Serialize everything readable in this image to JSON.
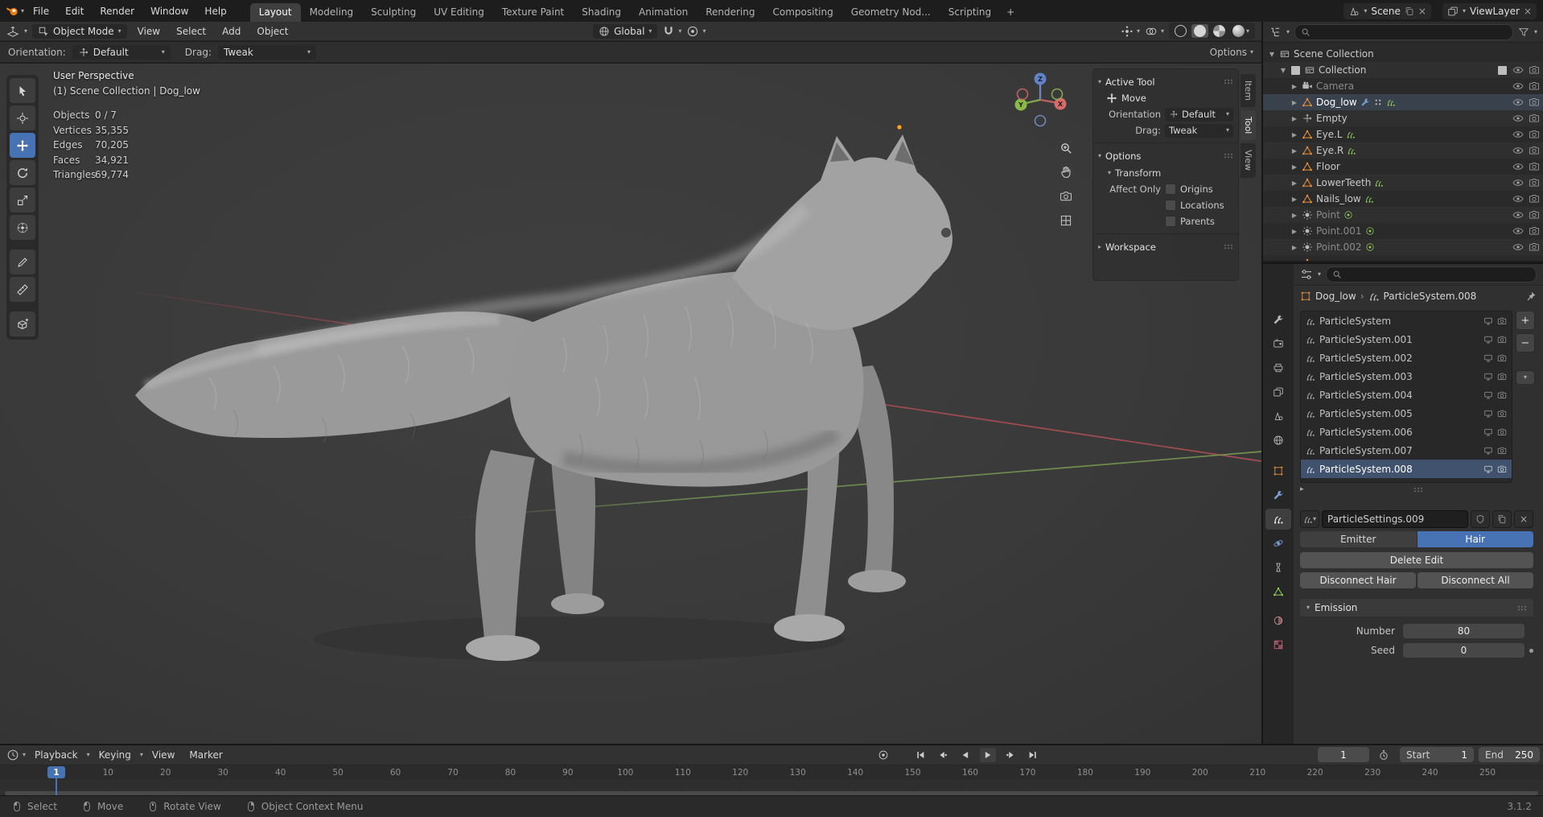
{
  "colors": {
    "accent": "#4772b3",
    "object_orange": "#e8913a",
    "mesh_green": "#8fce5a"
  },
  "topbar": {
    "menus": [
      "File",
      "Edit",
      "Render",
      "Window",
      "Help"
    ],
    "workspaces": [
      "Layout",
      "Modeling",
      "Sculpting",
      "UV Editing",
      "Texture Paint",
      "Shading",
      "Animation",
      "Rendering",
      "Compositing",
      "Geometry Nod...",
      "Scripting"
    ],
    "active_workspace": "Layout",
    "add_workspace": "+",
    "scene_name": "Scene",
    "view_layer_name": "ViewLayer"
  },
  "viewport_header": {
    "mode": "Object Mode",
    "menus": [
      "View",
      "Select",
      "Add",
      "Object"
    ],
    "orientation": "Global"
  },
  "tool_settings": {
    "orientation_label": "Orientation:",
    "orientation_value": "Default",
    "drag_label": "Drag:",
    "drag_value": "Tweak",
    "options_label": "Options"
  },
  "viewport": {
    "view_label": "User Perspective",
    "context_label": "(1) Scene Collection | Dog_low",
    "stats": [
      {
        "label": "Objects",
        "value": "0 / 7"
      },
      {
        "label": "Vertices",
        "value": "35,355"
      },
      {
        "label": "Edges",
        "value": "70,205"
      },
      {
        "label": "Faces",
        "value": "34,921"
      },
      {
        "label": "Triangles",
        "value": "69,774"
      }
    ],
    "axis": {
      "x": "X",
      "y": "Y",
      "z": "Z"
    }
  },
  "npanel": {
    "active_tool_label": "Active Tool",
    "tool_name": "Move",
    "orientation_label": "Orientation",
    "orientation_value": "Default",
    "drag_label": "Drag:",
    "drag_value": "Tweak",
    "options_label": "Options",
    "transform_label": "Transform",
    "affect_only_label": "Affect Only",
    "checkboxes": [
      "Origins",
      "Locations",
      "Parents"
    ],
    "workspace_label": "Workspace",
    "tabs": [
      "Item",
      "Tool",
      "View"
    ],
    "active_tab": "Tool"
  },
  "outliner": {
    "rows": [
      {
        "name": "Scene Collection"
      },
      {
        "name": "Collection"
      },
      {
        "name": "Camera"
      },
      {
        "name": "Dog_low"
      },
      {
        "name": "Empty"
      },
      {
        "name": "Eye.L"
      },
      {
        "name": "Eye.R"
      },
      {
        "name": "Floor"
      },
      {
        "name": "LowerTeeth"
      },
      {
        "name": "Nails_low"
      },
      {
        "name": "Point"
      },
      {
        "name": "Point.001"
      },
      {
        "name": "Point.002"
      }
    ]
  },
  "properties": {
    "breadcrumb": {
      "object": "Dog_low",
      "item": "ParticleSystem.008",
      "separator": "›"
    },
    "particle_systems": [
      "ParticleSystem",
      "ParticleSystem.001",
      "ParticleSystem.002",
      "ParticleSystem.003",
      "ParticleSystem.004",
      "ParticleSystem.005",
      "ParticleSystem.006",
      "ParticleSystem.007",
      "ParticleSystem.008"
    ],
    "active_particle_system": "ParticleSystem.008",
    "settings_name": "ParticleSettings.009",
    "emitter_label": "Emitter",
    "hair_label": "Hair",
    "active_type": "Hair",
    "delete_edit_label": "Delete Edit",
    "disconnect_hair_label": "Disconnect Hair",
    "disconnect_all_label": "Disconnect All",
    "emission": {
      "label": "Emission",
      "number_label": "Number",
      "number_value": "80",
      "seed_label": "Seed",
      "seed_value": "0"
    }
  },
  "timeline": {
    "menus": [
      "Playback",
      "Keying",
      "View",
      "Marker"
    ],
    "current_frame": "1",
    "start_label": "Start",
    "start_value": "1",
    "end_label": "End",
    "end_value": "250",
    "ticks": [
      10,
      20,
      30,
      40,
      50,
      60,
      70,
      80,
      90,
      100,
      110,
      120,
      130,
      140,
      150,
      160,
      170,
      180,
      190,
      200,
      210,
      220,
      230,
      240,
      250
    ]
  },
  "statusbar": {
    "hints": [
      {
        "icon": "mouse-left-icon",
        "label": "Select"
      },
      {
        "icon": "mouse-left-icon",
        "label": "Move"
      },
      {
        "icon": "mouse-middle-icon",
        "label": "Rotate View"
      },
      {
        "icon": "mouse-right-icon",
        "label": "Object Context Menu"
      }
    ],
    "version": "3.1.2"
  }
}
